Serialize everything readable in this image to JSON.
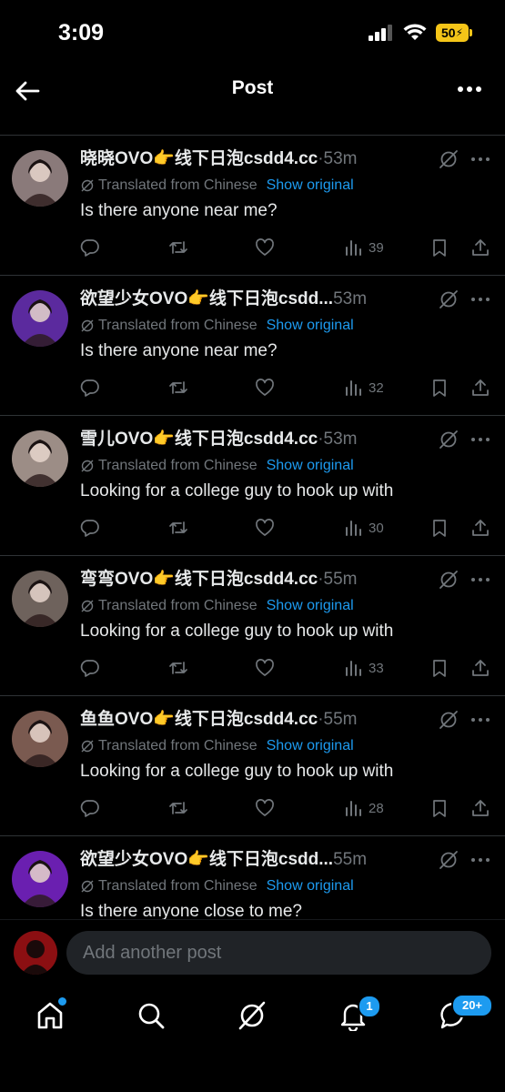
{
  "status_bar": {
    "time": "3:09",
    "battery": "50"
  },
  "header": {
    "title": "Post"
  },
  "posts": [
    {
      "author": "晓晓OVO👉线下日泡csdd4.cc",
      "separator": "·",
      "time": "53m",
      "translated": "Translated from Chinese",
      "show_original": "Show original",
      "text": "Is there anyone near me?",
      "views": "39",
      "avatar_color": "#8a7a7a"
    },
    {
      "author": "欲望少女OVO👉线下日泡csdd...",
      "separator": "",
      "time": "53m",
      "translated": "Translated from Chinese",
      "show_original": "Show original",
      "text": "Is there anyone near me?",
      "views": "32",
      "avatar_color": "#5b2a9e"
    },
    {
      "author": "雪儿OVO👉线下日泡csdd4.cc",
      "separator": "·",
      "time": "53m",
      "translated": "Translated from Chinese",
      "show_original": "Show original",
      "text": "Looking for a college guy to hook up with",
      "views": "30",
      "avatar_color": "#9c8d86"
    },
    {
      "author": "弯弯OVO👉线下日泡csdd4.cc",
      "separator": "·",
      "time": "55m",
      "translated": "Translated from Chinese",
      "show_original": "Show original",
      "text": "Looking for a college guy to hook up with",
      "views": "33",
      "avatar_color": "#6e625c"
    },
    {
      "author": "鱼鱼OVO👉线下日泡csdd4.cc",
      "separator": "·",
      "time": "55m",
      "translated": "Translated from Chinese",
      "show_original": "Show original",
      "text": "Looking for a college guy to hook up with",
      "views": "28",
      "avatar_color": "#7a5a50"
    },
    {
      "author": "欲望少女OVO👉线下日泡csdd...",
      "separator": "",
      "time": "55m",
      "translated": "Translated from Chinese",
      "show_original": "Show original",
      "text": "Is there anyone close to me?",
      "views": "",
      "avatar_color": "#6a1fb0"
    }
  ],
  "reply": {
    "placeholder": "Add another post"
  },
  "tab_bar": {
    "items": [
      "home-icon",
      "search-icon",
      "grok-icon",
      "notifications-icon",
      "messages-icon"
    ],
    "notifications_badge": "1",
    "messages_badge": "20+"
  },
  "colors": {
    "accent": "#1d9bf0",
    "muted": "#71767b",
    "background": "#000000"
  }
}
